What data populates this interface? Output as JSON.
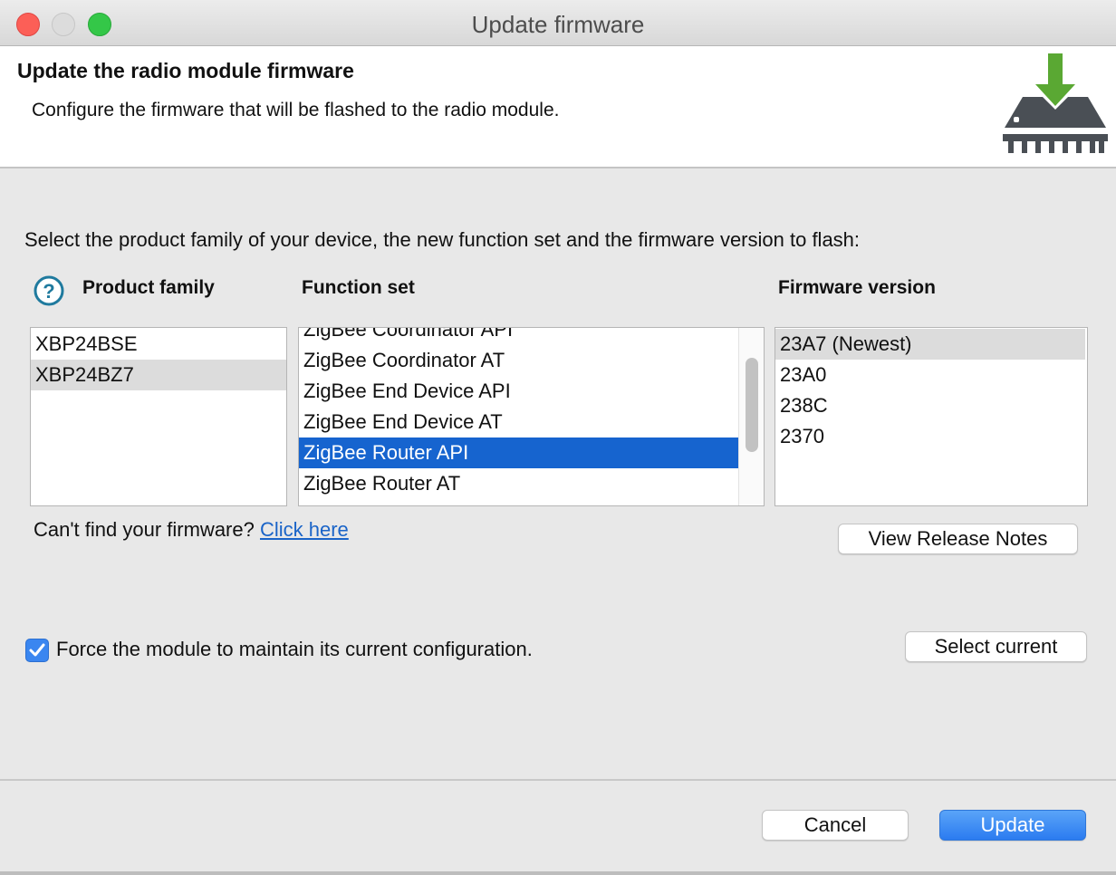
{
  "window": {
    "title": "Update firmware",
    "buttons": [
      "close",
      "minimize",
      "maximize"
    ]
  },
  "header": {
    "title": "Update the radio module firmware",
    "description": "Configure the firmware that will be flashed to the radio module.",
    "icon": "chip-download-icon"
  },
  "instruction": "Select the product family of your device, the new function set and the firmware version to flash:",
  "columns": {
    "product_family": "Product family",
    "function_set": "Function set",
    "firmware_version": "Firmware version"
  },
  "product_families": [
    {
      "label": "XBP24BSE",
      "selected": false
    },
    {
      "label": "XBP24BZ7",
      "selected": true
    }
  ],
  "function_sets": [
    {
      "label": "ZigBee Coordinator API",
      "selected": false
    },
    {
      "label": "ZigBee Coordinator AT",
      "selected": false
    },
    {
      "label": "ZigBee End Device API",
      "selected": false
    },
    {
      "label": "ZigBee End Device AT",
      "selected": false
    },
    {
      "label": "ZigBee Router API",
      "selected": true
    },
    {
      "label": "ZigBee Router AT",
      "selected": false
    }
  ],
  "firmware_versions": [
    {
      "label": "23A7 (Newest)",
      "selected": true
    },
    {
      "label": "23A0",
      "selected": false
    },
    {
      "label": "238C",
      "selected": false
    },
    {
      "label": "2370",
      "selected": false
    }
  ],
  "cant_find": {
    "text": "Can't find your firmware?",
    "link": "Click here"
  },
  "buttons": {
    "view_release_notes": "View Release Notes",
    "select_current": "Select current",
    "cancel": "Cancel",
    "update": "Update"
  },
  "force_config": {
    "label": "Force the module to maintain its current configuration.",
    "checked": true
  },
  "colors": {
    "selection_blue": "#1664cf",
    "selection_gray": "#dcdcdc",
    "link": "#1a64c8",
    "primary_button": "#2b7bf0"
  }
}
